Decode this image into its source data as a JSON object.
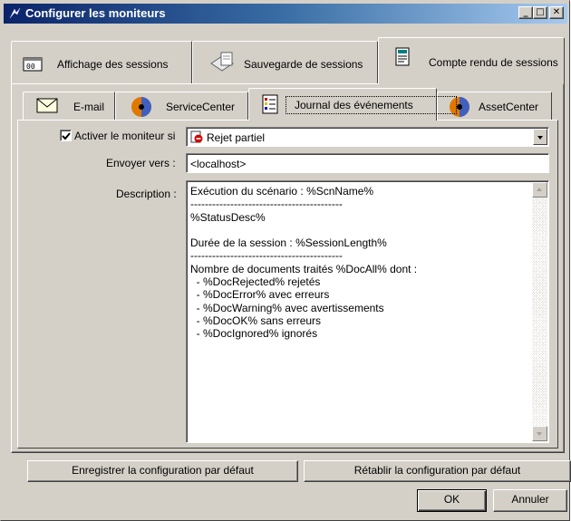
{
  "window": {
    "title": "Configurer les moniteurs",
    "min_glyph": "_",
    "max_glyph": "□",
    "close_glyph": "✕"
  },
  "outer_tabs": [
    {
      "label": "Affichage des sessions"
    },
    {
      "label": "Sauvegarde de sessions"
    },
    {
      "label": "Compte rendu de sessions",
      "active": true
    }
  ],
  "inner_tabs": [
    {
      "label": "E-mail"
    },
    {
      "label": "ServiceCenter"
    },
    {
      "label": "Journal des événements",
      "active": true
    },
    {
      "label": "AssetCenter"
    }
  ],
  "form": {
    "enable_label": "Activer le moniteur si",
    "enable_checked": true,
    "condition_value": "Rejet partiel",
    "send_to_label": "Envoyer vers :",
    "send_to_value": "<localhost>",
    "description_label": "Description :",
    "description_text": "Exécution du scénario : %ScnName%\n------------------------------------------\n%StatusDesc%\n\nDurée de la session : %SessionLength%\n------------------------------------------\nNombre de documents traités %DocAll% dont :\n  - %DocRejected% rejetés\n  - %DocError% avec erreurs\n  - %DocWarning% avec avertissements\n  - %DocOK% sans erreurs\n  - %DocIgnored% ignorés"
  },
  "buttons": {
    "save_default": "Enregistrer la configuration par défaut",
    "restore_default": "Rétablir la configuration par défaut",
    "ok": "OK",
    "cancel": "Annuler"
  },
  "colors": {
    "title_start": "#0a246a",
    "title_end": "#a6caf0",
    "face": "#d4d0c8"
  }
}
